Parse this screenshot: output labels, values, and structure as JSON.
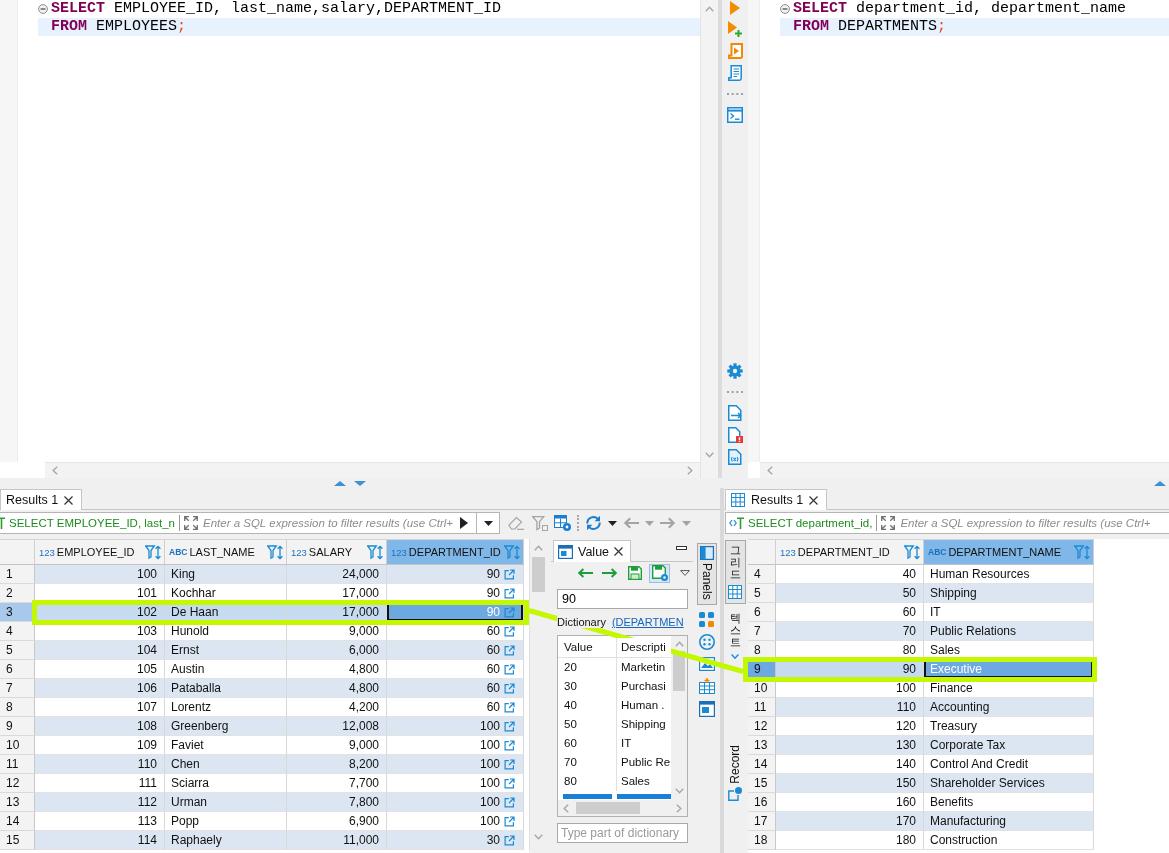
{
  "editors": [
    {
      "lines": [
        {
          "tokens": [
            {
              "kind": "keyword",
              "text": "SELECT"
            },
            {
              "kind": "plain",
              "text": " EMPLOYEE_ID, last_name,salary,DEPARTMENT_ID"
            }
          ],
          "foldable": true,
          "current": false
        },
        {
          "tokens": [
            {
              "kind": "keyword",
              "text": "FROM"
            },
            {
              "kind": "plain",
              "text": " EMPLOYEES"
            },
            {
              "kind": "delimiter",
              "text": ";"
            }
          ],
          "foldable": false,
          "current": true
        }
      ]
    },
    {
      "lines": [
        {
          "tokens": [
            {
              "kind": "keyword",
              "text": "SELECT"
            },
            {
              "kind": "plain",
              "text": " department_id, department_name"
            }
          ],
          "foldable": true,
          "current": false
        },
        {
          "tokens": [
            {
              "kind": "keyword",
              "text": "FROM"
            },
            {
              "kind": "plain",
              "text": " DEPARTMENTS"
            },
            {
              "kind": "delimiter",
              "text": ";"
            }
          ],
          "foldable": false,
          "current": true
        }
      ]
    }
  ],
  "results": [
    {
      "kind": "clipped-start",
      "tab": {
        "label": "Results 1",
        "selected": true
      },
      "filter": {
        "query": "SELECT EMPLOYEE_ID, last_n",
        "placeholder": "Enter a SQL expression to filter results (use Ctrl+"
      },
      "toolbar": [
        {
          "disabled": true
        },
        {
          "disabled": true
        },
        {
          "disabled": false
        },
        {
          "disabled": false
        },
        {
          "disabled": true
        },
        {
          "disabled": true
        }
      ],
      "table": {
        "stripe_first_row": true,
        "columns": [
          {
            "type": "123",
            "name": "EMPLOYEE_ID",
            "kind": "number",
            "selected": false
          },
          {
            "type": "ABC",
            "name": "LAST_NAME",
            "kind": "text",
            "selected": false
          },
          {
            "type": "123",
            "name": "SALARY",
            "kind": "number",
            "selected": false
          },
          {
            "type": "123",
            "name": "DEPARTMENT_ID",
            "kind": "reference",
            "selected": true
          }
        ],
        "rows": [
          {
            "number": "1",
            "cells": [
              "100",
              "King",
              "24,000",
              "90"
            ],
            "selected": false
          },
          {
            "number": "2",
            "cells": [
              "101",
              "Kochhar",
              "17,000",
              "90"
            ],
            "selected": false
          },
          {
            "number": "3",
            "cells": [
              "102",
              "De Haan",
              "17,000",
              "90"
            ],
            "selected": true
          },
          {
            "number": "4",
            "cells": [
              "103",
              "Hunold",
              "9,000",
              "60"
            ],
            "selected": false
          },
          {
            "number": "5",
            "cells": [
              "104",
              "Ernst",
              "6,000",
              "60"
            ],
            "selected": false
          },
          {
            "number": "6",
            "cells": [
              "105",
              "Austin",
              "4,800",
              "60"
            ],
            "selected": false
          },
          {
            "number": "7",
            "cells": [
              "106",
              "Pataballa",
              "4,800",
              "60"
            ],
            "selected": false
          },
          {
            "number": "8",
            "cells": [
              "107",
              "Lorentz",
              "4,200",
              "60"
            ],
            "selected": false
          },
          {
            "number": "9",
            "cells": [
              "108",
              "Greenberg",
              "12,008",
              "100"
            ],
            "selected": false
          },
          {
            "number": "10",
            "cells": [
              "109",
              "Faviet",
              "9,000",
              "100"
            ],
            "selected": false
          },
          {
            "number": "11",
            "cells": [
              "110",
              "Chen",
              "8,200",
              "100"
            ],
            "selected": false
          },
          {
            "number": "12",
            "cells": [
              "111",
              "Sciarra",
              "7,700",
              "100"
            ],
            "selected": false
          },
          {
            "number": "13",
            "cells": [
              "112",
              "Urman",
              "7,800",
              "100"
            ],
            "selected": false
          },
          {
            "number": "14",
            "cells": [
              "113",
              "Popp",
              "6,900",
              "100"
            ],
            "selected": false
          },
          {
            "number": "15",
            "cells": [
              "114",
              "Raphaely",
              "11,000",
              "30"
            ],
            "selected": false
          }
        ]
      },
      "value_panel": {
        "tab": {
          "label": "Value",
          "selected": true
        },
        "toolbar": [
          {
            "on": false
          },
          {
            "on": false
          },
          {
            "on": false
          },
          {
            "on": true
          }
        ],
        "value": "90",
        "dictionary": {
          "label": "Dictionary",
          "link": "(DEPARTMEN",
          "columns": [
            "Value",
            "Descripti"
          ],
          "rows": [
            [
              "20",
              "Marketin"
            ],
            [
              "30",
              "Purchasi"
            ],
            [
              "40",
              "Human ."
            ],
            [
              "50",
              "Shipping"
            ],
            [
              "60",
              "IT"
            ],
            [
              "70",
              "Public Re"
            ],
            [
              "80",
              "Sales"
            ]
          ],
          "clipped_row": {
            "selected": true
          },
          "search": {
            "placeholder": "Type part of dictionary"
          }
        }
      },
      "panels_toggle": {
        "label": "Panels",
        "on": true
      }
    },
    {
      "kind": "clipped-end",
      "tab": {
        "label": "Results 1",
        "selected": true
      },
      "filter": {
        "query": "SELECT department_id,",
        "placeholder": "Enter a SQL expression to filter results (use Ctrl+"
      },
      "side_tabs": [
        {
          "label": "그리드",
          "selected": true
        },
        {
          "label": "텍스트",
          "selected": false
        },
        {
          "label": "Record",
          "selected": false
        }
      ],
      "table": {
        "stripe_first_row": false,
        "columns": [
          {
            "type": "123",
            "name": "DEPARTMENT_ID",
            "kind": "number",
            "selected": false
          },
          {
            "type": "ABC",
            "name": "DEPARTMENT_NAME",
            "kind": "text",
            "selected": true
          }
        ],
        "rows": [
          {
            "number": "4",
            "cells": [
              "40",
              "Human Resources"
            ],
            "selected": false
          },
          {
            "number": "5",
            "cells": [
              "50",
              "Shipping"
            ],
            "selected": false
          },
          {
            "number": "6",
            "cells": [
              "60",
              "IT"
            ],
            "selected": false
          },
          {
            "number": "7",
            "cells": [
              "70",
              "Public Relations"
            ],
            "selected": false
          },
          {
            "number": "8",
            "cells": [
              "80",
              "Sales"
            ],
            "selected": false
          },
          {
            "number": "9",
            "cells": [
              "90",
              "Executive"
            ],
            "selected": true
          },
          {
            "number": "10",
            "cells": [
              "100",
              "Finance"
            ],
            "selected": false
          },
          {
            "number": "11",
            "cells": [
              "110",
              "Accounting"
            ],
            "selected": false
          },
          {
            "number": "12",
            "cells": [
              "120",
              "Treasury"
            ],
            "selected": false
          },
          {
            "number": "13",
            "cells": [
              "130",
              "Corporate Tax"
            ],
            "selected": false
          },
          {
            "number": "14",
            "cells": [
              "140",
              "Control And Credit"
            ],
            "selected": false
          },
          {
            "number": "15",
            "cells": [
              "150",
              "Shareholder Services"
            ],
            "selected": false
          },
          {
            "number": "16",
            "cells": [
              "160",
              "Benefits"
            ],
            "selected": false
          },
          {
            "number": "17",
            "cells": [
              "170",
              "Manufacturing"
            ],
            "selected": false
          },
          {
            "number": "18",
            "cells": [
              "180",
              "Construction"
            ],
            "selected": false
          }
        ]
      }
    }
  ],
  "annotation": {
    "kind": "row-link"
  }
}
